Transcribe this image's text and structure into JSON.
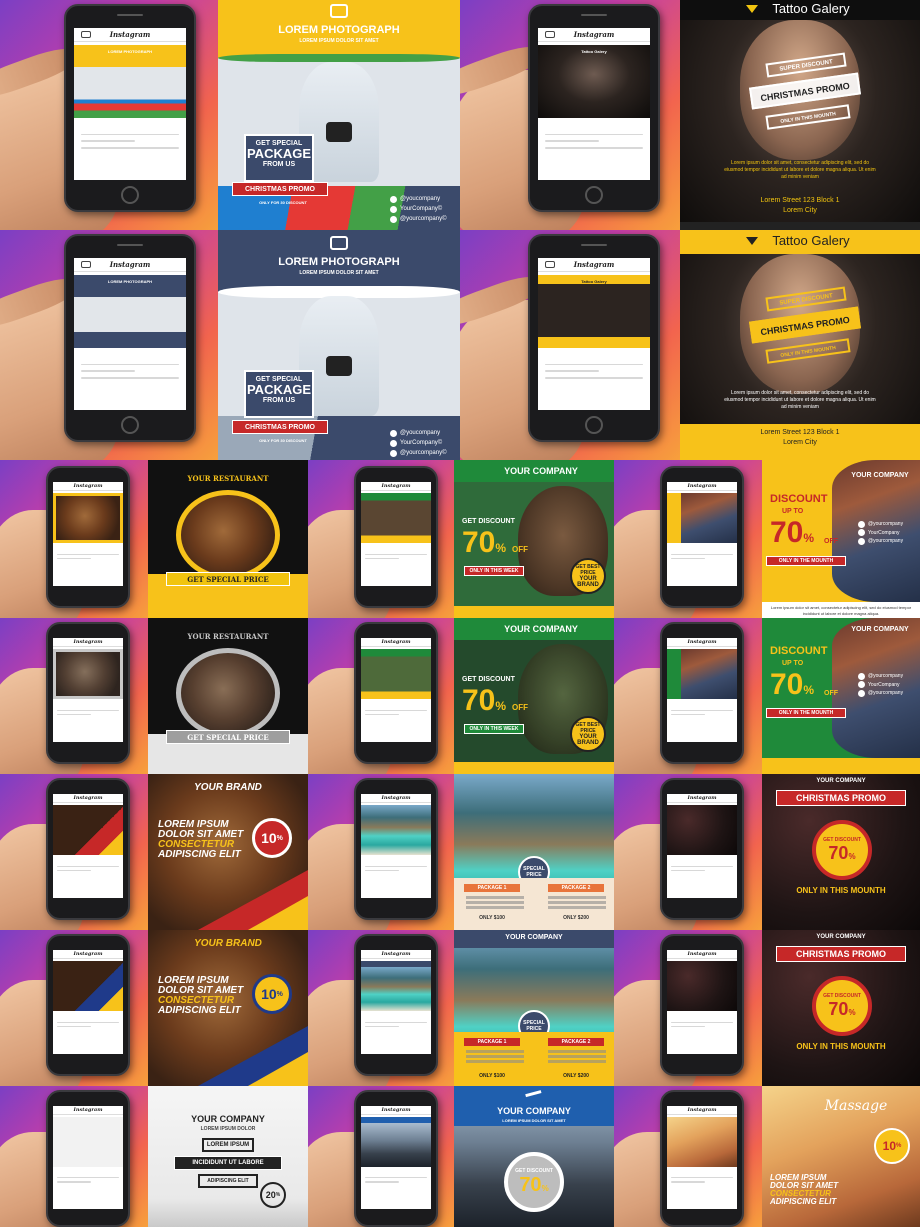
{
  "colors": {
    "instagram_bg": "#c23ea8",
    "yellow": "#f7c21a",
    "red": "#c62828",
    "navy": "#3b4a6b",
    "green": "#1f8a3a",
    "black": "#111111"
  },
  "phone_app": "Instagram",
  "photograph": {
    "title": "LOREM PHOTOGRAPH",
    "subtitle": "LOREM IPSUM DOLOR SIT AMET",
    "badge_line1": "GET SPECIAL",
    "badge_line2": "PACKAGE",
    "badge_line3": "FROM US",
    "ribbon": "CHRISTMAS PROMO",
    "ribbon_sub": "ONLY FOR 30 DISCOUNT",
    "contact1": "@youcompany",
    "contact2": "YourCompany©",
    "contact3": "@yourcompany©"
  },
  "tattoo": {
    "title": "Tattoo Galery",
    "line1": "SUPER DISCOUNT",
    "line2": "CHRISTMAS PROMO",
    "line3": "ONLY IN THIS MOUNTH",
    "body": "Lorem ipsum dolor sit amet, consectetur adipiscing elit, sed do eiusmod tempor incididunt ut labore et dolore magna aliqua. Ut enim ad minim veniam",
    "address1": "Lorem Street 123 Block 1",
    "address2": "Lorem City"
  },
  "restaurant": {
    "title": "YOUR RESTAURANT",
    "ribbon": "GET SPECIAL PRICE"
  },
  "bear": {
    "company": "YOUR COMPANY",
    "get_discount": "GET DISCOUNT",
    "percent": "70",
    "pct_sign": "%",
    "off": "OFF",
    "ribbon": "ONLY IN THIS WEEK",
    "badge_line1": "GET BEST PRICE",
    "badge_line2": "YOUR BRAND"
  },
  "fashion": {
    "company": "YOUR COMPANY",
    "discount": "DISCOUNT",
    "up_to": "UP TO",
    "percent": "70",
    "pct_sign": "%",
    "off": "OFF",
    "ribbon": "ONLY IN THE MOUNTH",
    "contact1": "@yourcompany",
    "contact2": "YourCompany",
    "contact3": "@yourcompany",
    "footer": "Lorem ipsum dolor sit amet, consectetur adipiscing elit, sed do eiusmod tempor incididunt ut labore et dolore magna aliqua."
  },
  "brand": {
    "title": "YOUR BRAND",
    "line1": "LOREM IPSUM",
    "line2": "DOLOR SIT AMET",
    "line3": "CONSECTETUR",
    "line4": "ADIPISCING ELIT",
    "percent": "10",
    "pct_sign": "%",
    "off": "OFF"
  },
  "travel": {
    "company": "YOUR COMPANY",
    "badge_line1": "SPECIAL",
    "badge_line2": "PRICE",
    "package1": "PACKAGE 1",
    "package2": "PACKAGE 2",
    "price1": "ONLY $100",
    "price2": "ONLY $200"
  },
  "xmas": {
    "company": "YOUR COMPANY",
    "ribbon": "CHRISTMAS PROMO",
    "get_discount": "GET DISCOUNT",
    "percent": "70",
    "pct_sign": "%",
    "footer": "ONLY IN THIS MOUNTH"
  },
  "logo_tpl": {
    "company": "YOUR COMPANY",
    "sub": "LOREM IPSUM DOLOR",
    "box1": "LOREM IPSUM",
    "ribbon": "INCIDIDUNT UT LABORE",
    "box2": "ADIPISCING ELIT",
    "percent": "20",
    "pct_sign": "%"
  },
  "car": {
    "company": "YOUR COMPANY",
    "sub": "LOREM IPSUM DOLOR SIT AMET",
    "get_discount": "GET DISCOUNT",
    "percent": "70",
    "pct_sign": "%"
  },
  "massage": {
    "title": "Massage",
    "line1": "LOREM IPSUM",
    "line2": "DOLOR SIT AMET",
    "line3": "CONSECTETUR",
    "line4": "ADIPISCING ELIT",
    "percent": "10",
    "pct_sign": "%"
  }
}
